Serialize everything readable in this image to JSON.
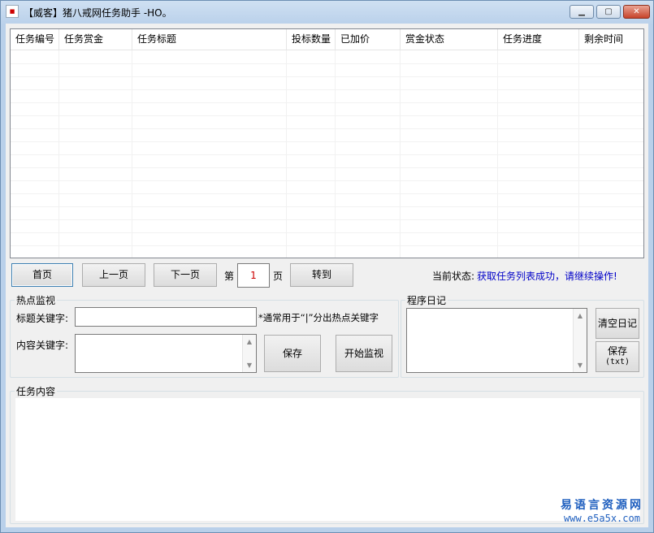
{
  "window": {
    "title": "【威客】猪八戒网任务助手  -HO。",
    "min_icon": "minimize-icon",
    "max_icon": "maximize-icon",
    "close_icon": "close-icon"
  },
  "table": {
    "columns": [
      "任务编号",
      "任务赏金",
      "任务标题",
      "投标数量",
      "已加价",
      "赏金状态",
      "任务进度",
      "剩余时间"
    ],
    "rows": []
  },
  "pager": {
    "first": "首页",
    "prev": "上一页",
    "next": "下一页",
    "page_prefix": "第",
    "page_value": "1",
    "page_suffix": "页",
    "goto": "转到"
  },
  "status": {
    "label": "当前状态:",
    "value": "获取任务列表成功，请继续操作!"
  },
  "hot_monitor": {
    "group_title": "热点监视",
    "title_kw_label": "标题关键字:",
    "title_kw_value": "",
    "hint": "*通常用于“|”分出热点关键字",
    "content_kw_label": "内容关键字:",
    "content_kw_value": "",
    "save": "保存",
    "start": "开始监视"
  },
  "log": {
    "group_title": "程序日记",
    "clear": "清空日记",
    "save_line1": "保存",
    "save_line2": "(txt)"
  },
  "task_content": {
    "group_title": "任务内容"
  },
  "watermark": {
    "cn": "易语言资源网",
    "en": "www.e5a5x.com"
  },
  "colors": {
    "status_value": "#0000c8",
    "page_value": "#cc0000",
    "watermark": "#1f5fbf"
  }
}
